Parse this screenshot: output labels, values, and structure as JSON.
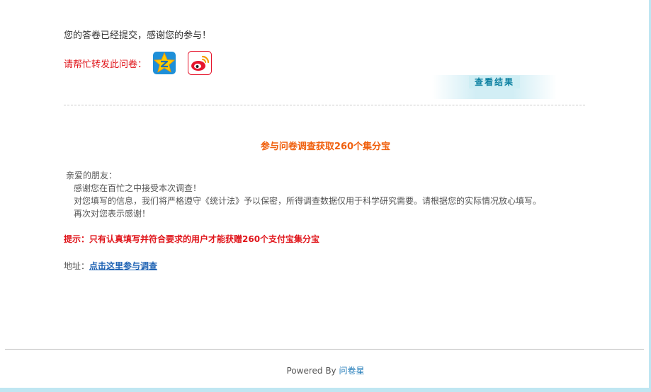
{
  "submit_message": "您的答卷已经提交，感谢您的参与！",
  "share": {
    "label": "请帮忙转发此问卷：",
    "buttons": [
      {
        "icon": "qzone-icon",
        "color": "#f5a300"
      },
      {
        "icon": "weibo-icon",
        "color": "#e6162d"
      }
    ]
  },
  "view_results_label": "查看结果",
  "survey": {
    "title": "参与问卷调查获取260个集分宝",
    "greeting": "亲爱的朋友：",
    "lines": [
      "感谢您在百忙之中接受本次调查！",
      "对您填写的信息，我们将严格遵守《统计法》予以保密，所得调查数据仅用于科学研究需要。请根据您的实际情况放心填写。",
      "再次对您表示感谢！"
    ]
  },
  "tip": "提示：只有认真填写并符合要求的用户才能获赠260个支付宝集分宝",
  "address": {
    "label": "地址：",
    "link_text": "点击这里参与调查"
  },
  "footer": {
    "powered_by": "Powered By",
    "brand": "问卷星"
  },
  "colors": {
    "accent_red": "#e0141a",
    "accent_orange": "#f0600e",
    "link_blue": "#1f63b4",
    "frame_blue": "#bfe6f2"
  }
}
